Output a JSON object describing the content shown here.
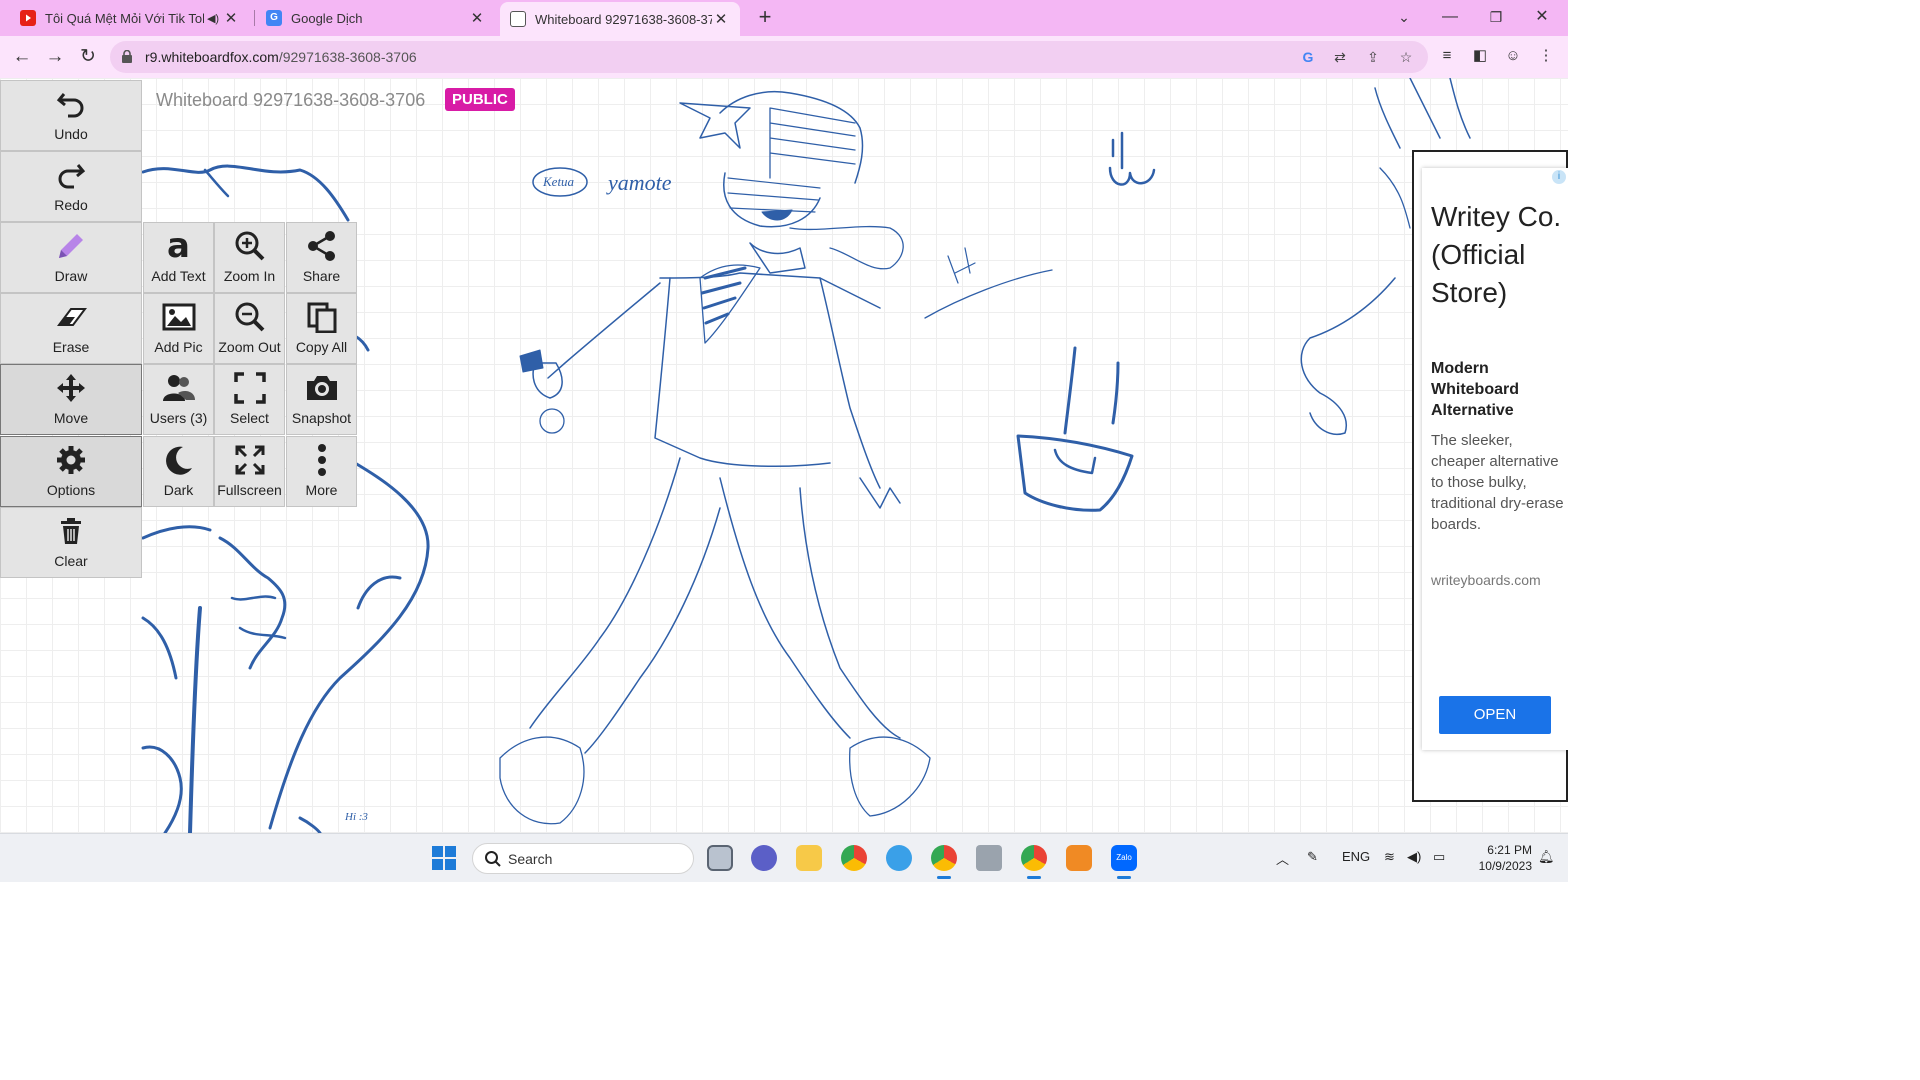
{
  "browser": {
    "tabs": [
      {
        "title": "Tôi Quá Mệt Mỏi Với Tik Tok",
        "icon": "youtube-icon",
        "audio": true
      },
      {
        "title": "Google Dịch",
        "icon": "google-translate-icon"
      },
      {
        "title": "Whiteboard 92971638-3608-3706",
        "icon": "whiteboard-icon",
        "active": true
      }
    ],
    "url_host": "r9.whiteboardfox.com",
    "url_path": "/92971638-3608-3706"
  },
  "whiteboard": {
    "title": "Whiteboard 92971638-3608-3706",
    "badge": "PUBLIC"
  },
  "tools": {
    "undo": "Undo",
    "redo": "Redo",
    "draw": "Draw",
    "erase": "Erase",
    "move": "Move",
    "options": "Options",
    "clear": "Clear",
    "add_text": "Add Text",
    "zoom_in": "Zoom In",
    "share": "Share",
    "add_pic": "Add Pic",
    "zoom_out": "Zoom Out",
    "copy_all": "Copy All",
    "users": "Users (3)",
    "select": "Select",
    "snapshot": "Snapshot",
    "dark": "Dark",
    "fullscreen": "Fullscreen",
    "more": "More"
  },
  "canvas_text": {
    "note1": "Ketua",
    "note2": "yamote",
    "note3": "Hi :3"
  },
  "ad": {
    "title": "Writey Co. (Official Store)",
    "subtitle": "Modern Whiteboard Alternative",
    "description": "The sleeker, cheaper alternative to those bulky, traditional dry-erase boards.",
    "domain": "writeyboards.com",
    "cta": "OPEN"
  },
  "taskbar": {
    "search_label": "Search",
    "language": "ENG",
    "time": "6:21 PM",
    "date": "10/9/2023"
  },
  "colors": {
    "tab_strip": "#f4b7f4",
    "ink": "#2f5fa8",
    "badge": "#d81ba6",
    "ad_button": "#1a73e8"
  }
}
